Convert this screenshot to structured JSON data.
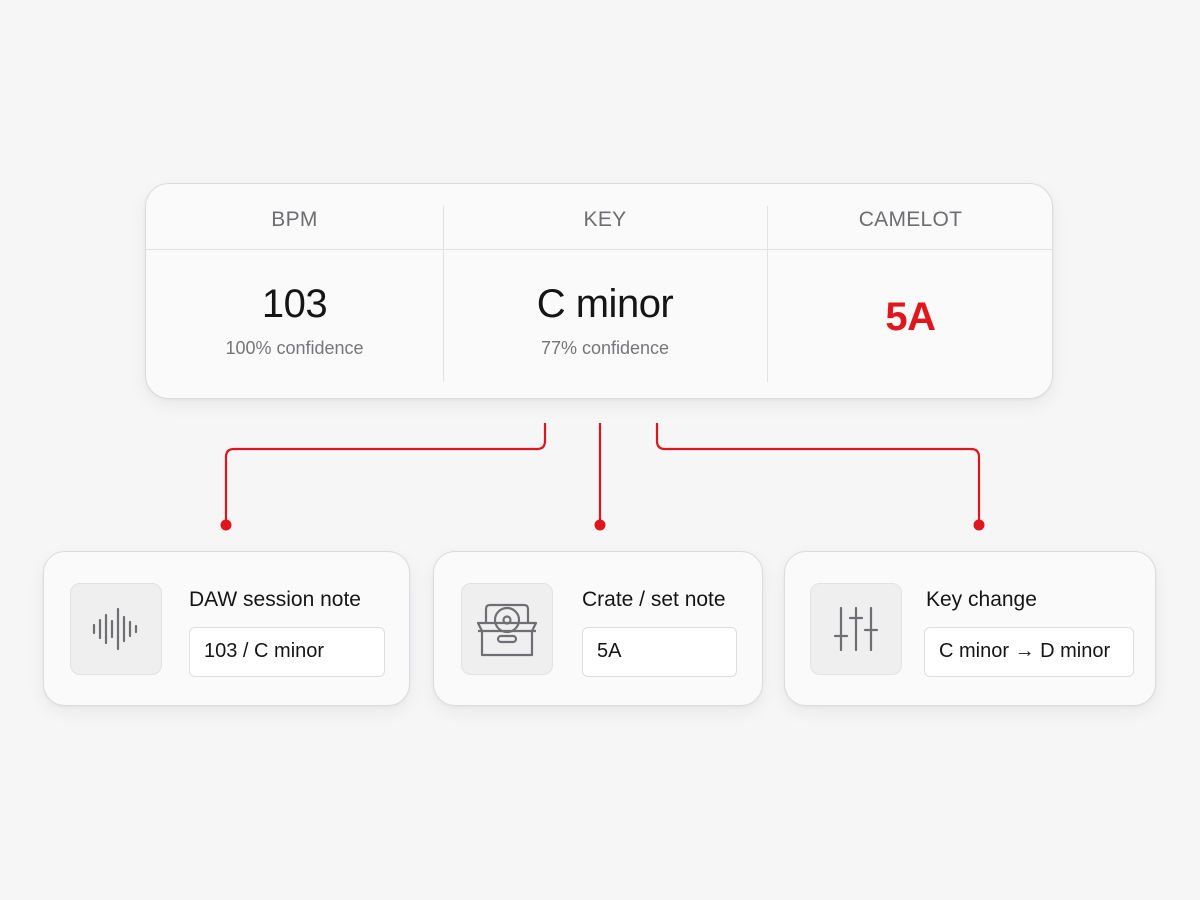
{
  "analysis": {
    "columns": [
      {
        "label": "BPM",
        "value": "103",
        "confidence": "100% confidence"
      },
      {
        "label": "KEY",
        "value": "C minor",
        "confidence": "77% confidence"
      },
      {
        "label": "CAMELOT",
        "value": "5A"
      }
    ]
  },
  "outputs": [
    {
      "title": "DAW session note",
      "value": "103 / C minor",
      "icon": "waveform-icon"
    },
    {
      "title": "Crate / set note",
      "value": "5A",
      "icon": "record-crate-icon"
    },
    {
      "title": "Key change",
      "value": "C minor → D minor",
      "icon": "mixer-sliders-icon"
    }
  ],
  "colors": {
    "accent": "#e0161d",
    "card_border": "#dcdcde",
    "background": "#f6f6f7"
  }
}
